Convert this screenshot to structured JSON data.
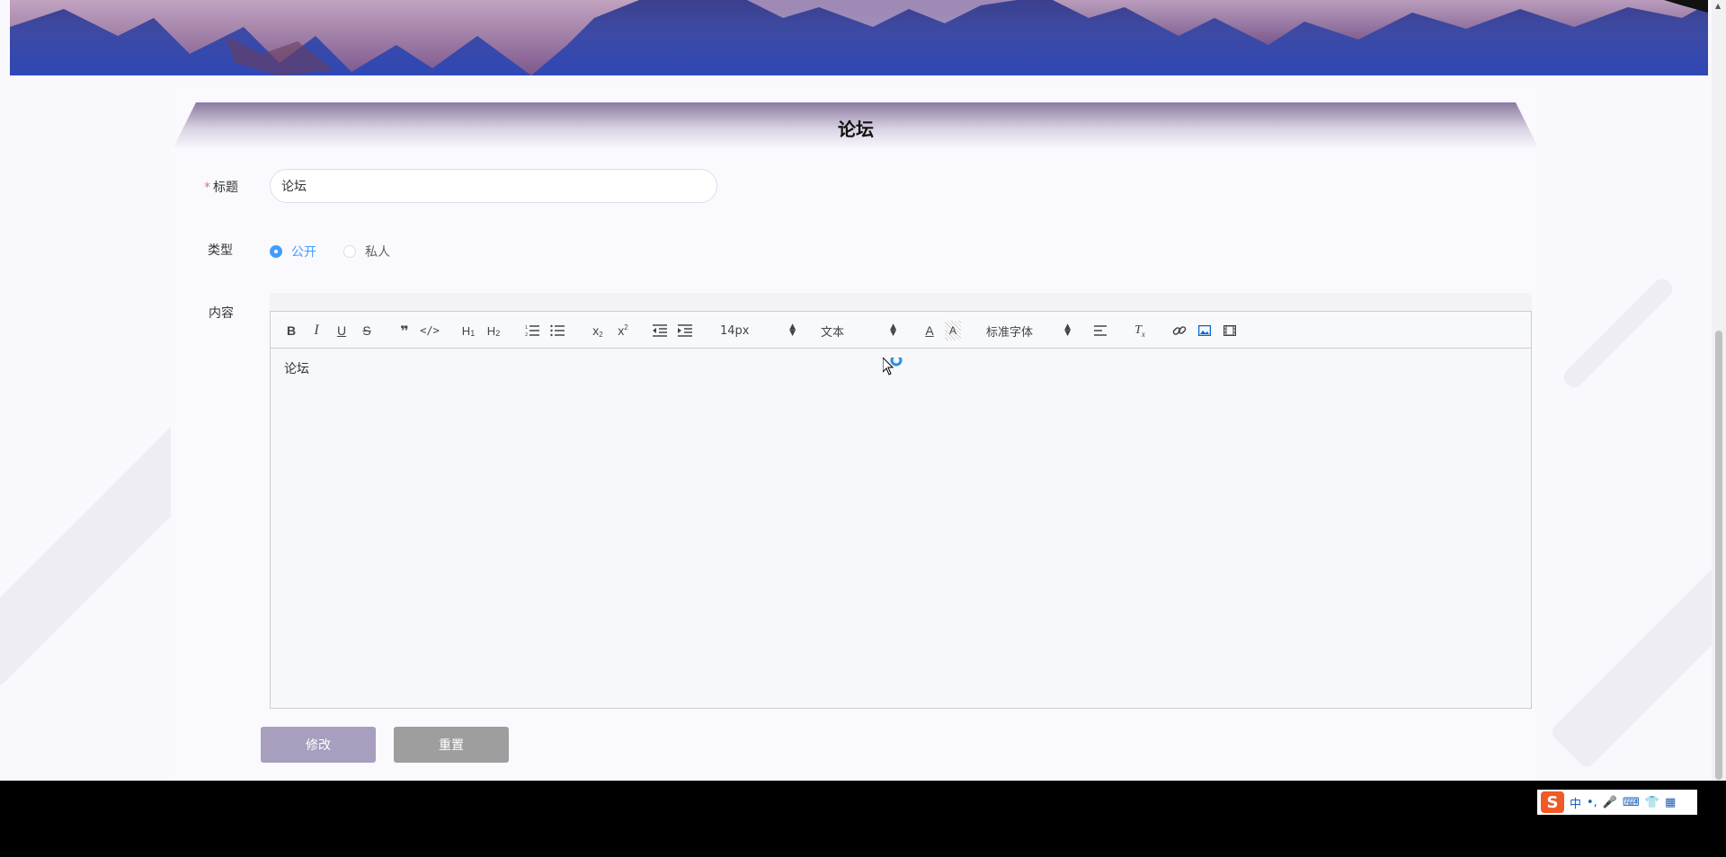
{
  "page": {
    "title": "论坛"
  },
  "form": {
    "title_label": "标题",
    "title_required_mark": "*",
    "title_value": "论坛",
    "type_label": "类型",
    "type_options": [
      {
        "label": "公开",
        "checked": true
      },
      {
        "label": "私人",
        "checked": false
      }
    ],
    "content_label": "内容",
    "content_text": "论坛"
  },
  "editor_toolbar": {
    "font_size": "14px",
    "header_select": "文本",
    "font_family": "标准字体",
    "icons": [
      "bold-icon",
      "italic-icon",
      "underline-icon",
      "strike-icon",
      "blockquote-icon",
      "code-block-icon",
      "h1-icon",
      "h2-icon",
      "ordered-list-icon",
      "bullet-list-icon",
      "subscript-icon",
      "superscript-icon",
      "outdent-icon",
      "indent-icon",
      "font-color-icon",
      "background-color-icon",
      "align-icon",
      "clean-format-icon",
      "link-icon",
      "image-icon",
      "video-icon"
    ]
  },
  "buttons": {
    "submit": "修改",
    "reset": "重置"
  },
  "ime": {
    "logo": "S",
    "mode": "中",
    "punct": "•,"
  },
  "colors": {
    "accent": "#409eff",
    "submit_button": "#a89ebd",
    "reset_button": "#9e9e9e",
    "required": "#f56c6c"
  }
}
